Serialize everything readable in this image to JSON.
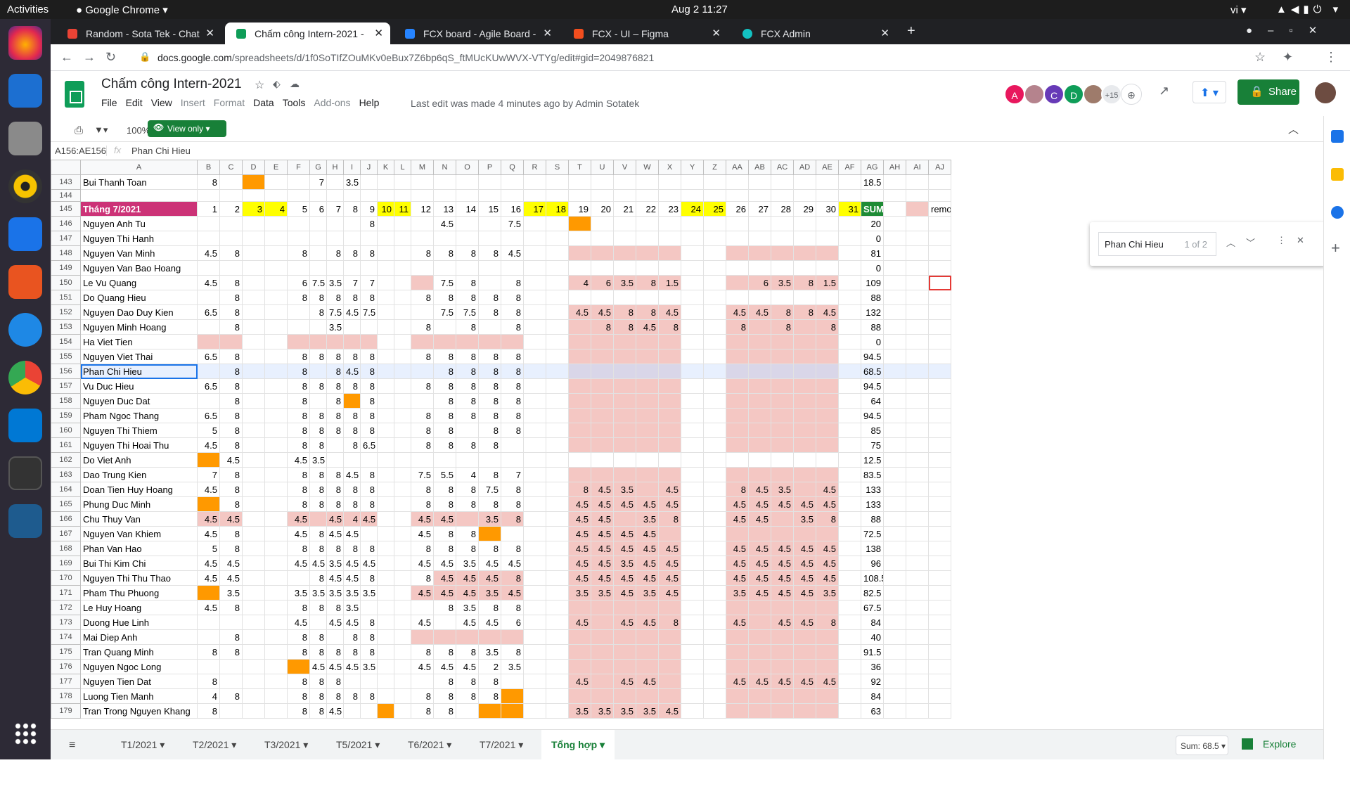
{
  "system": {
    "activities": "Activities",
    "app": "Google Chrome",
    "clock": "Aug 2  11:27",
    "lang": "vi"
  },
  "tabs": [
    {
      "title": "Random - Sota Tek - Chat",
      "color": "#ea4335"
    },
    {
      "title": "Chấm công Intern-2021 -",
      "color": "#0f9d58"
    },
    {
      "title": "FCX board - Agile Board -",
      "color": "#2684ff"
    },
    {
      "title": "FCX - UI – Figma",
      "color": "#f24e1e"
    },
    {
      "title": "FCX Admin",
      "color": "#13c2c2"
    }
  ],
  "address": {
    "domain": "docs.google.com",
    "path": "/spreadsheets/d/1f0SoTIfZOuMKv0eBux7Z6bp6qS_ftMUcKUwWVX-VTYg/edit#gid=2049876821"
  },
  "doc": {
    "title": "Chấm công Intern-2021",
    "menu": [
      "File",
      "Edit",
      "View",
      "Insert",
      "Format",
      "Data",
      "Tools",
      "Add-ons",
      "Help"
    ],
    "menu_disabled": [
      "Insert",
      "Format",
      "Add-ons"
    ],
    "last_edit": "Last edit was made 4 minutes ago by Admin Sotatek",
    "share": "Share",
    "avatars": [
      "A",
      "",
      "C",
      "D",
      ""
    ],
    "avatar_more": "+15"
  },
  "toolbar": {
    "zoom": "100%",
    "view_only": "View only"
  },
  "formula": {
    "cell_ref": "A156:AE156",
    "fx": "fx",
    "value": "Phan Chi Hieu"
  },
  "find": {
    "query": "Phan Chi Hieu",
    "count": "1 of 2"
  },
  "columns": [
    "A",
    "B",
    "C",
    "D",
    "E",
    "F",
    "G",
    "H",
    "I",
    "J",
    "K",
    "L",
    "M",
    "N",
    "O",
    "P",
    "Q",
    "R",
    "S",
    "T",
    "U",
    "V",
    "W",
    "X",
    "Y",
    "Z",
    "AA",
    "AB",
    "AC",
    "AD",
    "AE",
    "AF",
    "AG",
    "AH",
    "AI",
    "AJ"
  ],
  "legend": {
    "label": "remote"
  },
  "sheet_tabs": [
    "T1/2021",
    "T2/2021",
    "T3/2021",
    "T5/2021",
    "T6/2021",
    "T7/2021",
    "Tổng hợp"
  ],
  "active_sheet": "Tổng hợp",
  "sum_label": "Sum: 68.5",
  "explore": "Explore"
}
